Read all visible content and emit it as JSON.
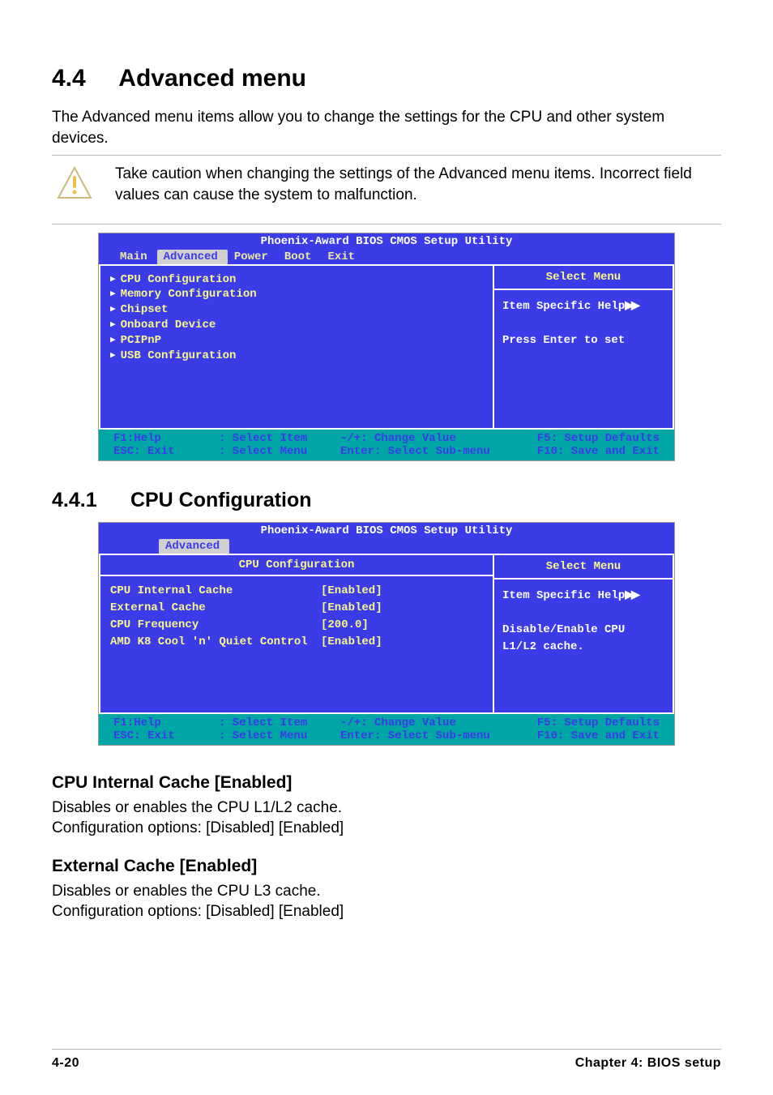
{
  "section": {
    "number": "4.4",
    "title": "Advanced menu",
    "intro": "The Advanced menu items allow you to change the settings for the CPU and other system devices.",
    "caution": "Take caution when changing the settings of the Advanced menu items. Incorrect field values can cause the system to malfunction."
  },
  "bios1": {
    "title": "Phoenix-Award BIOS CMOS Setup Utility",
    "tabs": [
      "Main",
      "Advanced",
      "Power",
      "Boot",
      "Exit"
    ],
    "active_tab": "Advanced",
    "items": [
      "CPU Configuration",
      "Memory Configuration",
      "Chipset",
      "Onboard Device",
      "PCIPnP",
      "USB Configuration"
    ],
    "right_title": "Select Menu",
    "right_lines": [
      "Item Specific Help",
      "",
      "Press Enter to set"
    ],
    "footer": {
      "f1": "F1:Help",
      "esc": "ESC: Exit",
      "updown_a": ": Select Item",
      "updown_b": ": Select Menu",
      "pm_a": "-/+: Change Value",
      "pm_b": "Enter: Select Sub-menu",
      "f5": "F5: Setup Defaults",
      "f10": "F10: Save and Exit"
    }
  },
  "subsection": {
    "number": "4.4.1",
    "title": "CPU Configuration"
  },
  "bios2": {
    "title": "Phoenix-Award BIOS CMOS Setup Utility",
    "active_tab": "Advanced",
    "panel_title": "CPU Configuration",
    "rows": [
      {
        "label": "CPU Internal Cache",
        "value": "[Enabled]"
      },
      {
        "label": "External Cache",
        "value": "[Enabled]"
      },
      {
        "label": "CPU Frequency",
        "value": "[200.0]"
      },
      {
        "label": "AMD K8 Cool 'n' Quiet Control",
        "value": "[Enabled]"
      }
    ],
    "right_title": "Select Menu",
    "right_lines": [
      "Item Specific Help",
      "",
      "Disable/Enable CPU L1/L2 cache."
    ],
    "footer": {
      "f1": "F1:Help",
      "esc": "ESC: Exit",
      "updown_a": ": Select Item",
      "updown_b": ": Select Menu",
      "pm_a": "-/+: Change Value",
      "pm_b": "Enter: Select Sub-menu",
      "f5": "F5: Setup Defaults",
      "f10": "F10: Save and Exit"
    }
  },
  "settings": [
    {
      "heading": "CPU Internal Cache [Enabled]",
      "desc1": "Disables or enables the CPU L1/L2 cache.",
      "desc2": "Configuration options:  [Disabled] [Enabled]"
    },
    {
      "heading": "External Cache [Enabled]",
      "desc1": "Disables or enables the CPU L3 cache.",
      "desc2": "Configuration options:  [Disabled] [Enabled]"
    }
  ],
  "footer": {
    "page": "4-20",
    "chapter": "Chapter 4: BIOS setup"
  }
}
